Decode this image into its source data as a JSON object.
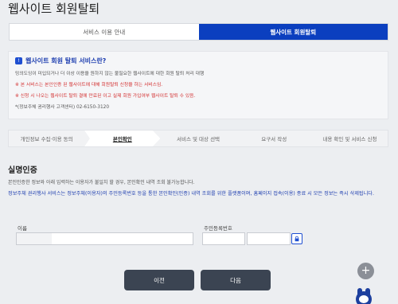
{
  "page_title": "웹사이트 회원탈퇴",
  "tabs": [
    "서비스 이용 안내",
    "웹사이트 회원탈퇴"
  ],
  "info": {
    "title": "웹사이트 회원 탈퇴 서비스란?",
    "lines": [
      "밍의도잉이 미입되거나 더 이상 이용을 원하지 않는 불필요한 웹사이트에 대한 회원 탈퇴 처리 대행",
      "※ 본 서비스는 본인인증 된 웹사이트에 대해 회원탈퇴 신청을 하는 서비스임.",
      "※ 신청 시 나오는 웹사이트 탈퇴 결에 만료된 이고 실제 회원 가입여부 웹사이트 탈퇴 수 있음.",
      "*(정보주체 권리행사 고객센터) 02-6150-3120"
    ]
  },
  "steps": [
    "개인정보 수집·이용 동의",
    "본인확인",
    "서비스 및 대상 선택",
    "요구서 작성",
    "내용 확인 및 서비스 신청"
  ],
  "section": {
    "title": "실명인증",
    "desc1": "본인인증한 정보와 아래 입력하는 이용자가 불일치 할 경우, 본인확인 내역 조회 불가능합니다.",
    "desc2": "정보주체 권리행사 서비스는 정보주체(이용자)의 주민등록번호 등을 통한 본인확인(인증) 내역 조회를 위한 플랫폼이며, 홈페이지 접속(이용) 종료 시 모든 정보는 즉시 삭제됩니다."
  },
  "form": {
    "name_label": "이름",
    "rrn_label": "주민등록번호"
  },
  "buttons": {
    "prev": "이전",
    "next": "다음"
  },
  "icons": {
    "info": "info-icon",
    "lock": "lock-icon",
    "plus": "plus-icon"
  },
  "colors": {
    "primary": "#0b3fbf",
    "dark_button": "#3b4452",
    "warning": "#d32f2f"
  }
}
